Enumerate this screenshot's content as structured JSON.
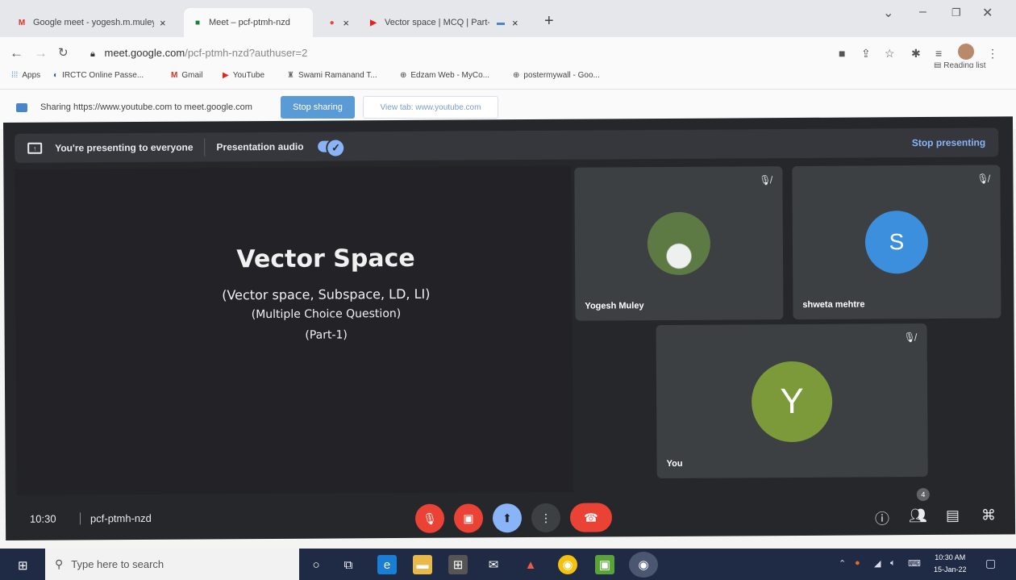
{
  "tabs": [
    {
      "icon": "gmail-icon",
      "title": "Google meet - yogesh.m.muley",
      "close": "×"
    },
    {
      "icon": "meet-icon",
      "title": "Meet – pcf-ptmh-nzd",
      "close": ""
    },
    {
      "icon": "recording-dot-icon",
      "title": "",
      "close": "×"
    },
    {
      "icon": "youtube-icon",
      "title": "Vector space | MCQ | Part-I",
      "close": "×"
    },
    {
      "icon": "presenting-icon",
      "title": "",
      "close": ""
    }
  ],
  "new_tab": "+",
  "address": {
    "host": "meet.google.com",
    "path": "/pcf-ptmh-nzd?authuser=2"
  },
  "reading_list": "Reading list",
  "bookmarks": [
    {
      "icon": "apps-icon",
      "label": "Apps"
    },
    {
      "icon": "irctc-icon",
      "label": "IRCTC Online Passe..."
    },
    {
      "icon": "gmail-icon",
      "label": "Gmail"
    },
    {
      "icon": "youtube-icon",
      "label": "YouTube"
    },
    {
      "icon": "ashram-icon",
      "label": "Swami Ramanand T..."
    },
    {
      "icon": "globe-icon",
      "label": "Edzam Web - MyCo..."
    },
    {
      "icon": "globe-icon",
      "label": "postermywall - Goo..."
    }
  ],
  "share": {
    "message": "Sharing https://www.youtube.com to meet.google.com",
    "stop": "Stop sharing",
    "view": "View tab: www.youtube.com"
  },
  "meet": {
    "presenting": "You're presenting to everyone",
    "audio": "Presentation audio",
    "stop_presenting": "Stop presenting",
    "slide": {
      "title": "Vector Space",
      "line1": "(Vector space, Subspace, LD, LI)",
      "line2": "(Multiple Choice Question)",
      "line3": "(Part-1)"
    },
    "participants": [
      {
        "name": "Yogesh Muley",
        "initial": "",
        "color": "#4a6b3a"
      },
      {
        "name": "shweta mehtre",
        "initial": "S",
        "color": "#3b8fdc"
      },
      {
        "name": "You",
        "initial": "Y",
        "color": "#7c9a3a"
      }
    ],
    "time": "10:30",
    "code": "pcf-ptmh-nzd",
    "participant_count": "4",
    "controls": {
      "mic": "mic-off-icon",
      "camera": "camera-off-icon",
      "present": "present-icon",
      "more": "more-icon",
      "leave": "end-call-icon"
    },
    "colors": {
      "red": "#ea4335",
      "present": "#8ab4f8",
      "bg": "#26272b",
      "tile": "#3c4043"
    }
  },
  "taskbar": {
    "search_placeholder": "Type here to search",
    "clock_time": "10:30 AM",
    "clock_date": "15-Jan-22"
  }
}
